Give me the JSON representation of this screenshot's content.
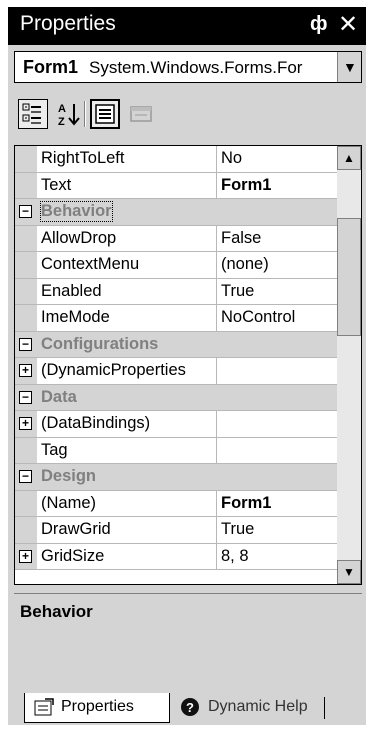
{
  "window": {
    "title": "Properties",
    "pin_glyph": "ф",
    "close_glyph": "✕"
  },
  "object_selector": {
    "name": "Form1",
    "type": "System.Windows.Forms.For",
    "dropdown_glyph": "▼"
  },
  "toolbar": {
    "buttons": [
      "categorized-icon",
      "alphabetical-icon",
      "properties-icon",
      "property-pages-icon"
    ]
  },
  "grid": {
    "rows": [
      {
        "kind": "prop",
        "name": "RightToLeft",
        "value": "No",
        "bold": false
      },
      {
        "kind": "prop",
        "name": "Text",
        "value": "Form1",
        "bold": true
      },
      {
        "kind": "cat",
        "name": "Behavior",
        "toggle": "−"
      },
      {
        "kind": "prop",
        "name": "AllowDrop",
        "value": "False",
        "bold": false
      },
      {
        "kind": "prop",
        "name": "ContextMenu",
        "value": "(none)",
        "bold": false
      },
      {
        "kind": "prop",
        "name": "Enabled",
        "value": "True",
        "bold": false
      },
      {
        "kind": "prop",
        "name": "ImeMode",
        "value": "NoControl",
        "bold": false
      },
      {
        "kind": "cat",
        "name": "Configurations",
        "toggle": "−"
      },
      {
        "kind": "expand",
        "name": "(DynamicProperties",
        "value": "",
        "toggle": "+"
      },
      {
        "kind": "cat",
        "name": "Data",
        "toggle": "−"
      },
      {
        "kind": "expand",
        "name": "(DataBindings)",
        "value": "",
        "toggle": "+"
      },
      {
        "kind": "prop",
        "name": "Tag",
        "value": "",
        "bold": false
      },
      {
        "kind": "cat",
        "name": "Design",
        "toggle": "−"
      },
      {
        "kind": "prop",
        "name": "(Name)",
        "value": "Form1",
        "bold": true
      },
      {
        "kind": "prop",
        "name": "DrawGrid",
        "value": "True",
        "bold": false
      },
      {
        "kind": "expand",
        "name": "GridSize",
        "value": "8, 8",
        "toggle": "+"
      }
    ],
    "scroll_up_glyph": "▲",
    "scroll_down_glyph": "▼"
  },
  "description": {
    "title": "Behavior"
  },
  "tabs": [
    {
      "label": "Properties",
      "icon": "properties-tab-icon",
      "active": true
    },
    {
      "label": "Dynamic Help",
      "icon": "help-icon",
      "active": false
    }
  ]
}
